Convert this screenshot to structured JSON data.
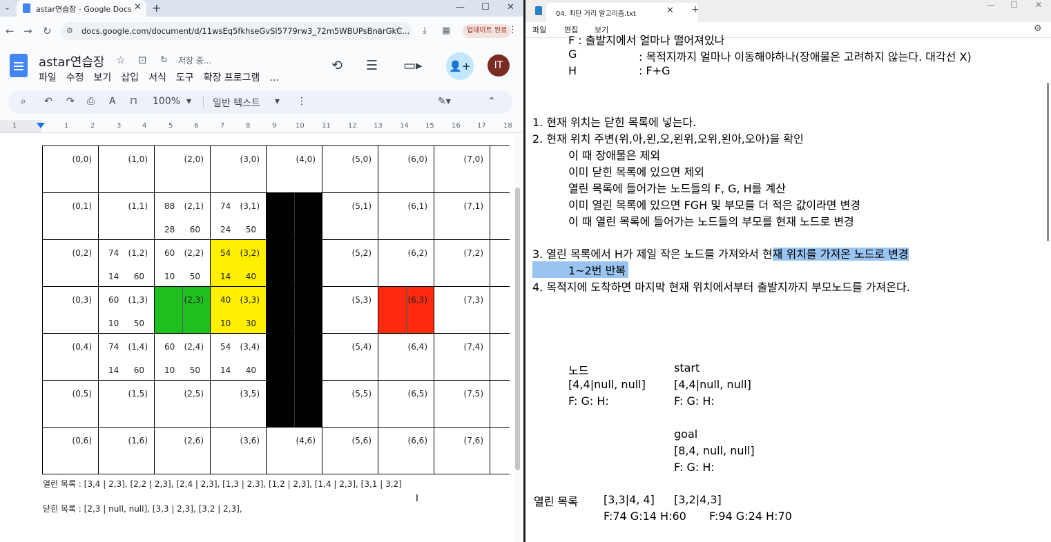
{
  "browser": {
    "tab_title": "astar연습장 - Google Docs",
    "url": "docs.google.com/document/d/11wsEq5fkhseGvSl5779rw3_72m5WBUPsBnarGkC...",
    "update_label": "업데이트 완료"
  },
  "docs": {
    "title": "astar연습장",
    "saving": "저장 중...",
    "menu": [
      "파일",
      "수정",
      "보기",
      "삽입",
      "서식",
      "도구",
      "확장 프로그램",
      "..."
    ],
    "zoom": "100%",
    "style": "일반 텍스트",
    "avatar": "IT",
    "ruler_ticks": [
      "1",
      "1",
      "2",
      "3",
      "4",
      "5",
      "6",
      "7",
      "8",
      "9",
      "10",
      "11",
      "12",
      "13",
      "14",
      "15",
      "16",
      "17",
      "18"
    ],
    "grid": {
      "rows": [
        [
          {
            "label": "(0,0)"
          },
          {
            "label": "(1,0)"
          },
          {
            "label": "(2,0)"
          },
          {
            "label": "(3,0)"
          },
          {
            "label": "(4,0)"
          },
          {
            "label": "(5,0)"
          },
          {
            "label": "(6,0)"
          },
          {
            "label": "(7,0)"
          }
        ],
        [
          {
            "label": "(0,1)"
          },
          {
            "label": "(1,1)"
          },
          {
            "label": "(2,1)",
            "f": "88",
            "g": "28",
            "h": "60"
          },
          {
            "label": "(3,1)",
            "f": "74",
            "g": "24",
            "h": "50"
          },
          {
            "label": "",
            "fill": "wall"
          },
          {
            "label": "(5,1)"
          },
          {
            "label": "(6,1)"
          },
          {
            "label": "(7,1)"
          }
        ],
        [
          {
            "label": "(0,2)"
          },
          {
            "label": "(1,2)",
            "f": "74",
            "g": "14",
            "h": "60"
          },
          {
            "label": "(2,2)",
            "f": "60",
            "g": "10",
            "h": "50"
          },
          {
            "label": "(3,2)",
            "f": "54",
            "g": "14",
            "h": "40",
            "fill": "open"
          },
          {
            "label": "",
            "fill": "wall"
          },
          {
            "label": "(5,2)"
          },
          {
            "label": "(6,2)"
          },
          {
            "label": "(7,2)"
          }
        ],
        [
          {
            "label": "(0,3)"
          },
          {
            "label": "(1,3)",
            "f": "60",
            "g": "10",
            "h": "50"
          },
          {
            "label": "(2,3)",
            "fill": "start"
          },
          {
            "label": "(3,3)",
            "f": "40",
            "g": "10",
            "h": "30",
            "fill": "open"
          },
          {
            "label": "",
            "fill": "wall"
          },
          {
            "label": "(5,3)"
          },
          {
            "label": "(6,3)",
            "fill": "goal"
          },
          {
            "label": "(7,3)"
          }
        ],
        [
          {
            "label": "(0,4)"
          },
          {
            "label": "(1,4)",
            "f": "74",
            "g": "14",
            "h": "60"
          },
          {
            "label": "(2,4)",
            "f": "60",
            "g": "10",
            "h": "50"
          },
          {
            "label": "(3,4)",
            "f": "54",
            "g": "14",
            "h": "40"
          },
          {
            "label": "",
            "fill": "wall"
          },
          {
            "label": "(5,4)"
          },
          {
            "label": "(6,4)"
          },
          {
            "label": "(7,4)"
          }
        ],
        [
          {
            "label": "(0,5)"
          },
          {
            "label": "(1,5)"
          },
          {
            "label": "(2,5)"
          },
          {
            "label": "(3,5)"
          },
          {
            "label": "",
            "fill": "wall"
          },
          {
            "label": "(5,5)"
          },
          {
            "label": "(6,5)"
          },
          {
            "label": "(7,5)"
          }
        ],
        [
          {
            "label": "(0,6)"
          },
          {
            "label": "(1,6)"
          },
          {
            "label": "(2,6)"
          },
          {
            "label": "(3,6)"
          },
          {
            "label": "(4,6)"
          },
          {
            "label": "(5,6)"
          },
          {
            "label": "(6,6)"
          },
          {
            "label": "(7,6)"
          }
        ]
      ]
    },
    "open_list": "열린 목록 : [3,4 | 2,3], [2,2 | 2,3], [2,4 | 2,3], [1,3 | 2,3], [1,2 | 2,3], [1,4 | 2,3], [3,1 | 3,2]",
    "closed_list": "닫힌 목록 : [2,3 | null, null], [3,3 | 2,3], [3,2 | 2,3],"
  },
  "notepad": {
    "tab_title": "04. 최단 거리 알고리즘.txt",
    "menu": [
      "파일",
      "편집",
      "보기"
    ],
    "lines": {
      "f_partial": "F             : 출발지에서 얼마나 떨어져있나",
      "g_line_key": "G",
      "g_line_val": ": 목적지까지 얼마나 이동해야하나(장애물은 고려하지 않는다. 대각선 X)",
      "h_line_key": "H",
      "h_line_val": ": F+G",
      "s1": "1. 현재 위치는 닫힌 목록에 넣는다.",
      "s2": "2. 현재 위치 주변(위,아,왼,오,왼위,오위,왼아,오아)을 확인",
      "s2a": "이 때 장애물은 제외",
      "s2b": "이미 닫힌 목록에 있으면 제외",
      "s2c": "열린 목록에 들어가는 노드들의 F, G, H를 계산",
      "s2d": "이미 열린 목록에 있으면 FGH 및 부모를 더 적은 값이라면 변경",
      "s2e": "이 때 열린 목록에 들어가는 노드들의 부모를 현재 노드로 변경",
      "s3_pre": "3. 열린 목록에서 H가 제일 작은 노드를 가져와서 현",
      "s3_hl": "재 위치를 가져온 노드로 변경",
      "s3b": "1~2번 반복",
      "s4": "4. 목적지에 도착하면 마지막 현재 위치에서부터 출발지까지 부모노드를 가져온다.",
      "node_h": "노드",
      "node_v": "[4,4|null, null]",
      "node_fgh": "F: G: H:",
      "start_h": "start",
      "start_v": "[4,4|null, null]",
      "start_fgh": "F: G: H:",
      "goal_h": "goal",
      "goal_v": "[8,4, null, null]",
      "goal_fgh": "F: G: H:",
      "open_h": "열린 목록",
      "open1": "[3,3|4, 4]",
      "open1_fgh": "F:74 G:14 H:60",
      "open2": "[3,2|4,3]",
      "open2_fgh": "F:94 G:24 H:70"
    }
  }
}
